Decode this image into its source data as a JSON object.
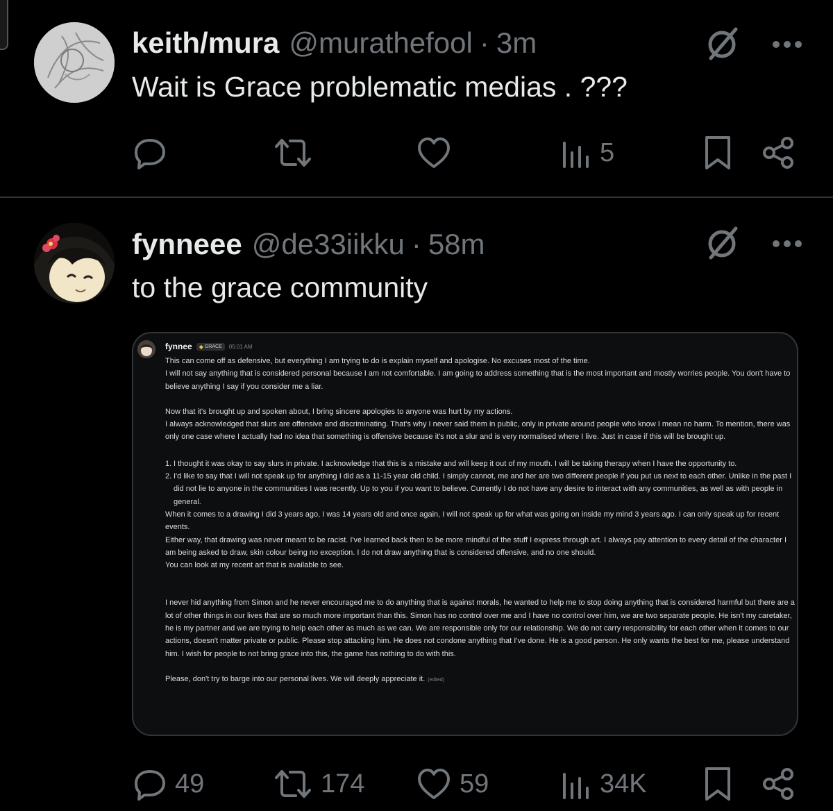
{
  "tweets": [
    {
      "name": "keith/mura",
      "handle": "@murathefool",
      "separator": "·",
      "time": "3m",
      "text": "Wait is Grace problematic medias . ???",
      "stats": {
        "replies": "",
        "reposts": "",
        "likes": "",
        "views": "5"
      }
    },
    {
      "name": "fynneee",
      "handle": "@de33iikku",
      "separator": "·",
      "time": "58m",
      "text": "to the grace community",
      "stats": {
        "replies": "49",
        "reposts": "174",
        "likes": "59",
        "views": "34K"
      },
      "attachment": {
        "author": "fynnee",
        "tag": "GRACE",
        "time": "05:01 AM",
        "p1": "This can come off as defensive, but everything I am trying to do is explain myself and apologise. No excuses most of the time.",
        "p2": "I will not say anything that is considered personal because I am not comfortable. I am going to address something that is the most important and mostly worries people. You don't have to believe anything I say if you consider me a liar.",
        "p3": "Now that it's brought up and spoken about, I bring sincere apologies to anyone was hurt by my actions.",
        "p4": "I always acknowledged that slurs are offensive and discriminating. That's why I never said them in public, only in private around people who know I mean no harm.  To mention, there was only one case where I actually had no idea that something is offensive because it's not a slur and is very normalised where I live. Just in case if this will be brought up.",
        "list": [
          {
            "num": "1.",
            "text": "I thought it was okay to say slurs in private. I acknowledge that this is a mistake and will keep it out of my mouth. I will be taking therapy when I have the opportunity to."
          },
          {
            "num": "2.",
            "text": "I'd like to say that I will not speak up for anything I did as a 11-15 year old child. I simply cannot, me and her are two different people if you put us next to each other.  Unlike in the past I did not lie to anyone in the communities I was recently. Up to you if you want to believe. Currently I do not have any desire to interact with any communities, as well as with people in general."
          }
        ],
        "p5": "When it comes to a drawing I did 3 years ago, I was 14 years old and once again, I will not speak up for what was going on inside my mind 3 years ago. I can only speak up for recent events.",
        "p6": "Either way, that drawing was never meant to be racist. I've learned back then to be more mindful of the stuff I express through art. I always pay attention to every detail of the character I am being asked to draw, skin colour being no exception. I do not draw anything that is considered offensive, and no one should.",
        "p7": "You can look at my recent art that is available to see.",
        "p8": "I never hid anything from Simon and he never encouraged me to do anything that is against morals, he wanted to help me to stop doing anything that is considered harmful but there are a lot of other things in our lives that are so much more important than this. Simon has no control over me and I have no control over him, we are two separate people. He isn't my caretaker, he is my partner and we are trying to help each other as much as we can. We are responsible only for our relationship. We do not carry responsibility for each other when it comes to our actions, doesn't matter private or public. Please stop attacking him. He does not condone anything that I've done. He is a good person. He only wants the best for me, please understand him. I wish for people to not bring grace into this, the game has nothing to do with this.",
        "p9": "Please, don't try to barge into our personal lives. We will deeply appreciate it.",
        "edited": "(edited)"
      }
    }
  ],
  "icons": {
    "grok": "grok-icon",
    "more": "more-icon",
    "reply": "reply-icon",
    "repost": "repost-icon",
    "like": "like-icon",
    "views": "views-icon",
    "bookmark": "bookmark-icon",
    "share": "share-icon"
  },
  "colors": {
    "background": "#000000",
    "text": "#e7e9ea",
    "muted": "#71767b",
    "divider": "#2f3336"
  }
}
